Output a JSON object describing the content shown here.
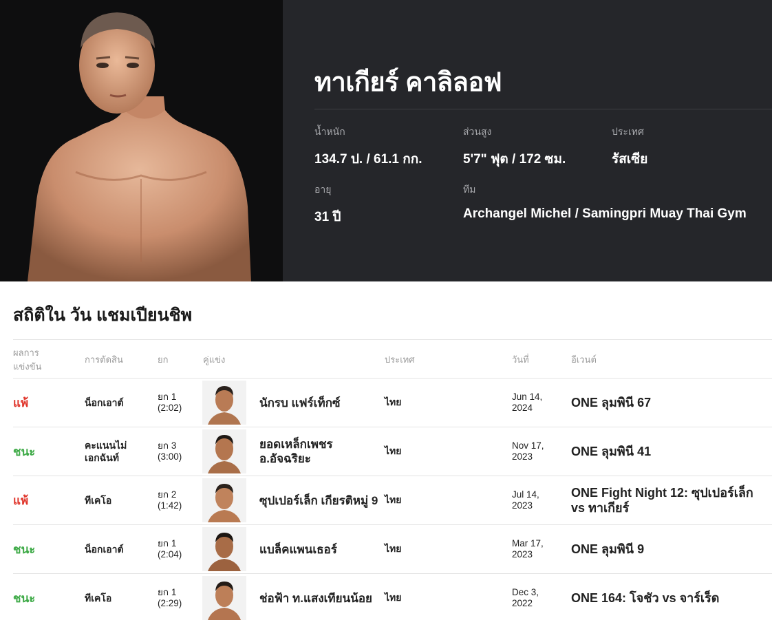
{
  "fighter": {
    "name": "ทาเกียร์ คาลิลอฟ",
    "stats": {
      "weight_label": "น้ำหนัก",
      "weight_value": "134.7 ป. / 61.1 กก.",
      "height_label": "ส่วนสูง",
      "height_value": "5'7\" ฟุต / 172 ซม.",
      "country_label": "ประเทศ",
      "country_value": "รัสเซีย",
      "age_label": "อายุ",
      "age_value": "31 ปี",
      "team_label": "ทีม",
      "team_value": "Archangel Michel / Samingpri Muay Thai Gym"
    }
  },
  "record": {
    "title": "สถิติใน วัน แชมเปียนชิพ",
    "headers": {
      "result": "ผลการ แข่งขัน",
      "method": "การตัดสิน",
      "round": "ยก",
      "opponent": "คู่แข่ง",
      "country": "ประเทศ",
      "date": "วันที่",
      "event": "อีเวนต์"
    },
    "rows": [
      {
        "result": "แพ้",
        "outcome": "loss",
        "method": "น็อกเอาต์",
        "round": "ยก 1",
        "time": "(2:02)",
        "opponent": "นักรบ แฟร์เท็กซ์",
        "country": "ไทย",
        "date_md": "Jun 14,",
        "date_y": "2024",
        "event": "ONE ลุมพินี 67"
      },
      {
        "result": "ชนะ",
        "outcome": "win",
        "method": "คะแนนไม่เอกฉันท์",
        "round": "ยก 3",
        "time": "(3:00)",
        "opponent": "ยอดเหล็กเพชร อ.อัจฉริยะ",
        "country": "ไทย",
        "date_md": "Nov 17,",
        "date_y": "2023",
        "event": "ONE ลุมพินี 41"
      },
      {
        "result": "แพ้",
        "outcome": "loss",
        "method": "ทีเคโอ",
        "round": "ยก 2",
        "time": "(1:42)",
        "opponent": "ซุปเปอร์เล็ก เกียรติหมู่ 9",
        "country": "ไทย",
        "date_md": "Jul 14,",
        "date_y": "2023",
        "event": "ONE Fight Night 12: ซุปเปอร์เล็ก vs ทาเกียร์"
      },
      {
        "result": "ชนะ",
        "outcome": "win",
        "method": "น็อกเอาต์",
        "round": "ยก 1",
        "time": "(2:04)",
        "opponent": "แบล็คแพนเธอร์",
        "country": "ไทย",
        "date_md": "Mar 17,",
        "date_y": "2023",
        "event": "ONE ลุมพินี 9"
      },
      {
        "result": "ชนะ",
        "outcome": "win",
        "method": "ทีเคโอ",
        "round": "ยก 1",
        "time": "(2:29)",
        "opponent": "ช่อฟ้า ท.แสงเทียนน้อย",
        "country": "ไทย",
        "date_md": "Dec 3,",
        "date_y": "2022",
        "event": "ONE 164: โจชัว vs จาร์เร็ด"
      }
    ]
  },
  "colors": {
    "hero_bg": "#25262a",
    "photo_bg": "#0e0e0f",
    "loss": "#e0352b",
    "win": "#3eaa47"
  }
}
